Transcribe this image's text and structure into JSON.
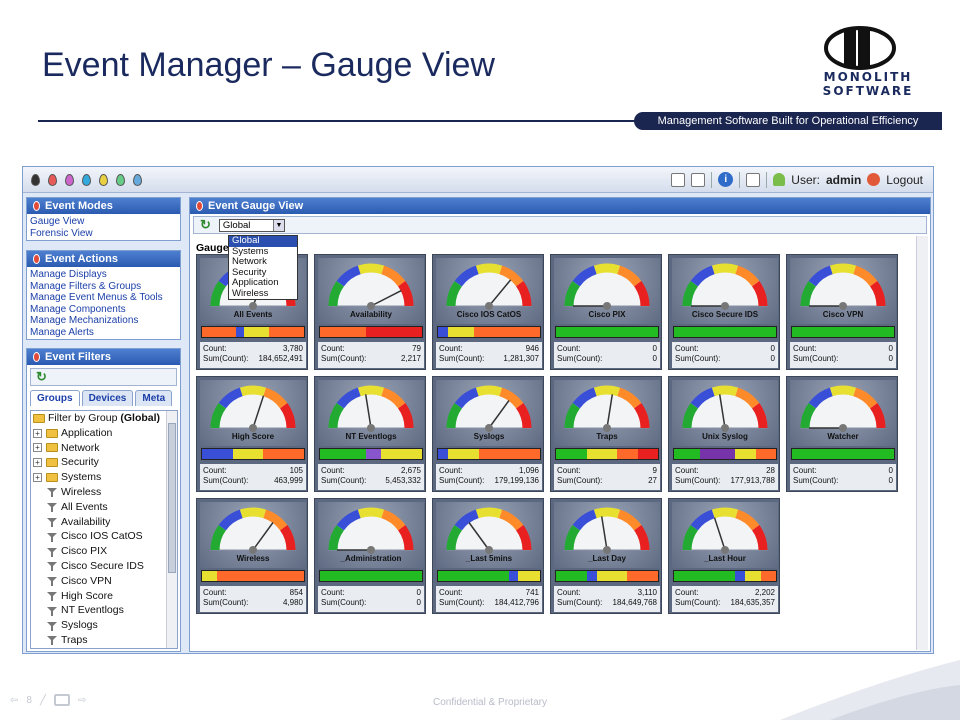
{
  "slide": {
    "title": "Event Manager – Gauge View",
    "tagline": "Management Software Built for Operational Efficiency",
    "logo_line1": "MONOLITH",
    "logo_line2": "SOFTWARE",
    "footer": "Confidential & Proprietary",
    "page_number": "8"
  },
  "topbar": {
    "drop_colors": [
      "#333333",
      "#e85a5a",
      "#cc66cc",
      "#33aadd",
      "#e8d040",
      "#66cc88",
      "#66aadd"
    ],
    "user_label": "User:",
    "user_name": "admin",
    "logout_label": "Logout",
    "icons": [
      "monitor-icon",
      "window-icon",
      "info-icon",
      "edit-icon",
      "user-icon",
      "logout-icon"
    ]
  },
  "event_modes": {
    "title": "Event Modes",
    "items": [
      "Gauge View",
      "Forensic View"
    ]
  },
  "event_actions": {
    "title": "Event Actions",
    "items": [
      "Manage Displays",
      "Manage Filters & Groups",
      "Manage Event Menus & Tools",
      "Manage Components",
      "Manage Mechanizations",
      "Manage Alerts"
    ]
  },
  "event_filters": {
    "title": "Event Filters",
    "tabs": [
      "Groups",
      "Devices",
      "Meta"
    ],
    "root": "Filter by Group",
    "root_suffix": "(Global)",
    "groups": [
      "Application",
      "Network",
      "Security",
      "Systems"
    ],
    "filters": [
      "Wireless",
      "All Events",
      "Availability",
      "Cisco IOS CatOS",
      "Cisco PIX",
      "Cisco Secure IDS",
      "Cisco VPN",
      "High Score",
      "NT Eventlogs",
      "Syslogs",
      "Traps"
    ]
  },
  "gauge_view": {
    "title": "Event Gauge View",
    "select_value": "Global",
    "gauge_label": "Gauge",
    "dropdown_options": [
      "Global",
      "Systems",
      "Network",
      "Security",
      "Application",
      "Wireless"
    ],
    "count_label": "Count:",
    "sum_label": "Sum(Count):",
    "gauges": [
      {
        "name": "All Events",
        "count": "3,780",
        "sum": "184,652,491",
        "needle": 0.62,
        "bar": [
          [
            "#ff6a2a",
            0.33
          ],
          [
            "#3a4fd8",
            0.08
          ],
          [
            "#e8e030",
            0.25
          ],
          [
            "#ff6a2a",
            0.34
          ]
        ]
      },
      {
        "name": "Availability",
        "count": "79",
        "sum": "2,217",
        "needle": 0.85,
        "bar": [
          [
            "#ff6a2a",
            0.45
          ],
          [
            "#e82020",
            0.55
          ]
        ]
      },
      {
        "name": "Cisco IOS CatOS",
        "count": "946",
        "sum": "1,281,307",
        "needle": 0.72,
        "bar": [
          [
            "#3a4fd8",
            0.1
          ],
          [
            "#e8e030",
            0.25
          ],
          [
            "#ff6a2a",
            0.65
          ]
        ]
      },
      {
        "name": "Cisco PIX",
        "count": "0",
        "sum": "0",
        "needle": 0.0,
        "bar": [
          [
            "#22bb22",
            1
          ]
        ]
      },
      {
        "name": "Cisco Secure IDS",
        "count": "0",
        "sum": "0",
        "needle": 0.0,
        "bar": [
          [
            "#22bb22",
            1
          ]
        ]
      },
      {
        "name": "Cisco VPN",
        "count": "0",
        "sum": "0",
        "needle": 0.0,
        "bar": [
          [
            "#22bb22",
            1
          ]
        ]
      },
      {
        "name": "High Score",
        "count": "105",
        "sum": "463,999",
        "needle": 0.6,
        "bar": [
          [
            "#3a4fd8",
            0.3
          ],
          [
            "#e8e030",
            0.3
          ],
          [
            "#ff6a2a",
            0.4
          ]
        ]
      },
      {
        "name": "NT Eventlogs",
        "count": "2,675",
        "sum": "5,453,332",
        "needle": 0.45,
        "bar": [
          [
            "#22bb22",
            0.45
          ],
          [
            "#8855cc",
            0.15
          ],
          [
            "#e8e030",
            0.4
          ]
        ]
      },
      {
        "name": "Syslogs",
        "count": "1,096",
        "sum": "179,199,136",
        "needle": 0.7,
        "bar": [
          [
            "#3a4fd8",
            0.1
          ],
          [
            "#e8e030",
            0.3
          ],
          [
            "#ff6a2a",
            0.6
          ]
        ]
      },
      {
        "name": "Traps",
        "count": "9",
        "sum": "27",
        "needle": 0.55,
        "bar": [
          [
            "#22bb22",
            0.3
          ],
          [
            "#e8e030",
            0.3
          ],
          [
            "#ff6a2a",
            0.2
          ],
          [
            "#e82020",
            0.2
          ]
        ]
      },
      {
        "name": "Unix Syslog",
        "count": "28",
        "sum": "177,913,788",
        "needle": 0.45,
        "bar": [
          [
            "#22bb22",
            0.25
          ],
          [
            "#7733aa",
            0.35
          ],
          [
            "#e8e030",
            0.2
          ],
          [
            "#ff6a2a",
            0.2
          ]
        ]
      },
      {
        "name": "Watcher",
        "count": "0",
        "sum": "0",
        "needle": 0.0,
        "bar": [
          [
            "#22bb22",
            1
          ]
        ]
      },
      {
        "name": "Wireless",
        "count": "854",
        "sum": "4,980",
        "needle": 0.7,
        "bar": [
          [
            "#e8e030",
            0.15
          ],
          [
            "#ff6a2a",
            0.85
          ]
        ]
      },
      {
        "name": "_Administration",
        "count": "0",
        "sum": "0",
        "needle": 0.0,
        "bar": [
          [
            "#22bb22",
            1
          ]
        ]
      },
      {
        "name": "_Last 5mins",
        "count": "741",
        "sum": "184,412,796",
        "needle": 0.3,
        "bar": [
          [
            "#22bb22",
            0.7
          ],
          [
            "#3a4fd8",
            0.08
          ],
          [
            "#e8e030",
            0.22
          ]
        ]
      },
      {
        "name": "_Last Day",
        "count": "3,110",
        "sum": "184,649,768",
        "needle": 0.45,
        "bar": [
          [
            "#22bb22",
            0.3
          ],
          [
            "#3a4fd8",
            0.1
          ],
          [
            "#e8e030",
            0.3
          ],
          [
            "#ff6a2a",
            0.3
          ]
        ]
      },
      {
        "name": "_Last Hour",
        "count": "2,202",
        "sum": "184,635,357",
        "needle": 0.4,
        "bar": [
          [
            "#22bb22",
            0.6
          ],
          [
            "#3a4fd8",
            0.1
          ],
          [
            "#e8e030",
            0.15
          ],
          [
            "#ff6a2a",
            0.15
          ]
        ]
      }
    ]
  }
}
